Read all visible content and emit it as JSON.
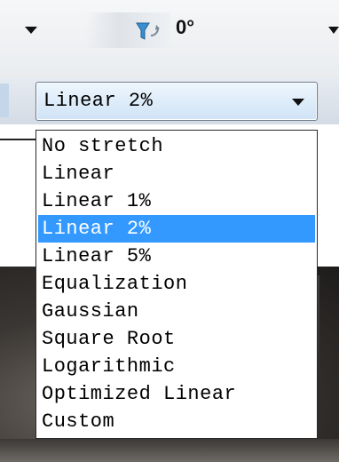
{
  "toolbar": {
    "rotate_icon": "rotate-icon",
    "rotation_value": "0°"
  },
  "stretch_combo": {
    "selected": "Linear 2%",
    "arrow_icon": "chevron-down-icon"
  },
  "stretch_options": [
    {
      "label": "No stretch",
      "selected": false
    },
    {
      "label": "Linear",
      "selected": false
    },
    {
      "label": "Linear 1%",
      "selected": false
    },
    {
      "label": "Linear 2%",
      "selected": true
    },
    {
      "label": "Linear 5%",
      "selected": false
    },
    {
      "label": "Equalization",
      "selected": false
    },
    {
      "label": "Gaussian",
      "selected": false
    },
    {
      "label": "Square Root",
      "selected": false
    },
    {
      "label": "Logarithmic",
      "selected": false
    },
    {
      "label": "Optimized Linear",
      "selected": false
    },
    {
      "label": "Custom",
      "selected": false
    }
  ],
  "colors": {
    "highlight": "#3399ff",
    "highlight_text": "#ffffff"
  }
}
